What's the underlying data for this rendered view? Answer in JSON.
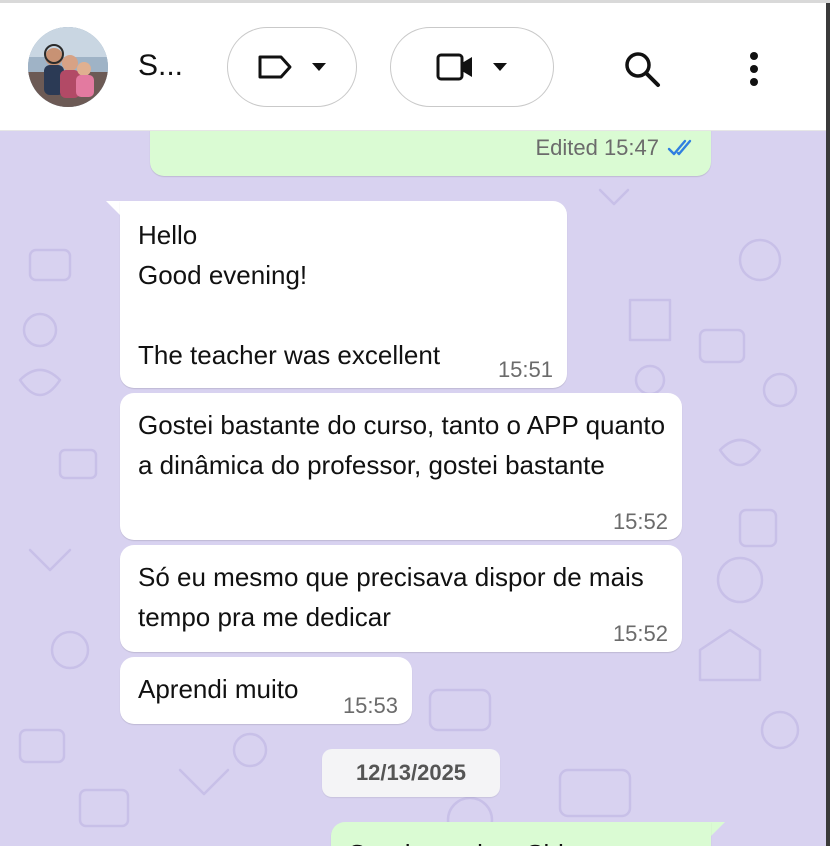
{
  "header": {
    "contact_name": "S...",
    "avatar_icon": "group-photo-avatar",
    "label_icon": "label-icon",
    "video_icon": "video-camera-icon",
    "dropdown_icon": "chevron-down-icon",
    "search_icon": "search-icon",
    "menu_icon": "more-vert-icon"
  },
  "messages": {
    "outgoing_top": {
      "meta": "Edited 15:47",
      "status_icon": "double-check-icon",
      "status_color": "#2f7fe0"
    },
    "incoming": [
      {
        "text": "Hello\nGood evening!\n\nThe teacher was excellent",
        "time": "15:51"
      },
      {
        "text": "Gostei bastante do curso, tanto o APP quanto a dinâmica do professor, gostei bastante",
        "time": "15:52"
      },
      {
        "text": "Só eu mesmo que precisava dispor de mais tempo pra me dedicar",
        "time": "15:52"
      },
      {
        "text": "Aprendi muito",
        "time": "15:53"
      }
    ],
    "date_separator": "12/13/2025",
    "outgoing_bottom": {
      "text": "Good morning, Sid..."
    }
  },
  "colors": {
    "chat_background": "#d8d2f0",
    "incoming_bubble": "#ffffff",
    "outgoing_bubble": "#dafbd3"
  }
}
